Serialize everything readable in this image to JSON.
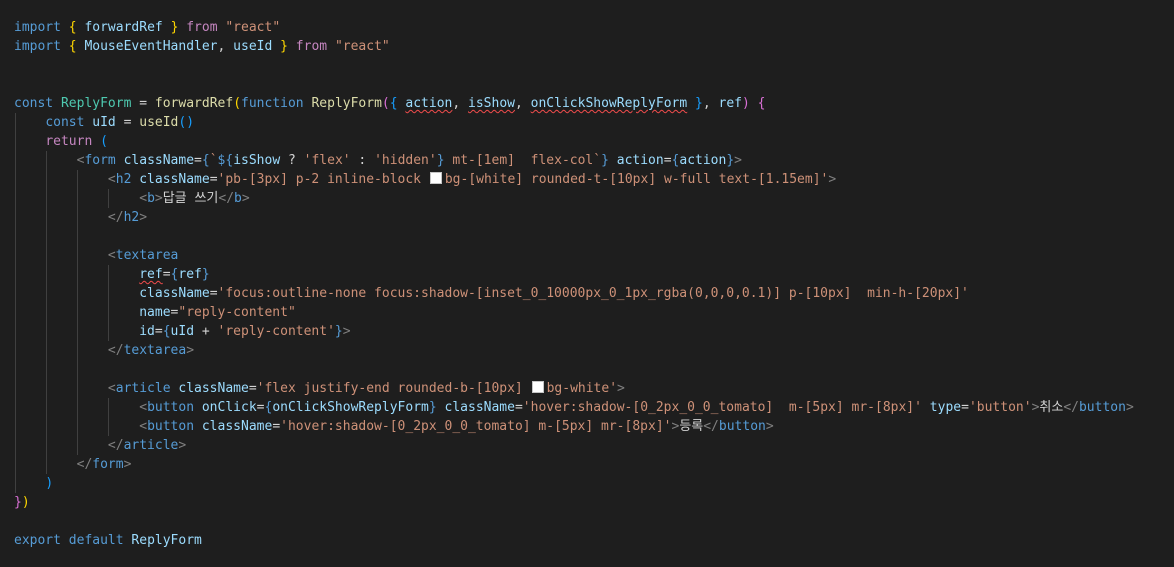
{
  "editor": {
    "background": "#1e1e1e",
    "lines": [
      [
        [
          "k",
          "import"
        ],
        [
          "p",
          " "
        ],
        [
          "y",
          "{"
        ],
        [
          "p",
          " "
        ],
        [
          "v",
          "forwardRef"
        ],
        [
          "p",
          " "
        ],
        [
          "y",
          "}"
        ],
        [
          "p",
          " "
        ],
        [
          "c",
          "from"
        ],
        [
          "p",
          " "
        ],
        [
          "s",
          "\"react\""
        ]
      ],
      [
        [
          "k",
          "import"
        ],
        [
          "p",
          " "
        ],
        [
          "y",
          "{"
        ],
        [
          "p",
          " "
        ],
        [
          "v",
          "MouseEventHandler"
        ],
        [
          "p",
          ", "
        ],
        [
          "v",
          "useId"
        ],
        [
          "p",
          " "
        ],
        [
          "y",
          "}"
        ],
        [
          "p",
          " "
        ],
        [
          "c",
          "from"
        ],
        [
          "p",
          " "
        ],
        [
          "s",
          "\"react\""
        ]
      ],
      [],
      [],
      [
        [
          "k",
          "const"
        ],
        [
          "p",
          " "
        ],
        [
          "ty",
          "ReplyForm"
        ],
        [
          "p",
          " = "
        ],
        [
          "f",
          "forwardRef"
        ],
        [
          "y",
          "("
        ],
        [
          "k",
          "function"
        ],
        [
          "p",
          " "
        ],
        [
          "f",
          "ReplyForm"
        ],
        [
          "m",
          "("
        ],
        [
          "bl",
          "{"
        ],
        [
          "p",
          " "
        ],
        [
          "vq",
          "action"
        ],
        [
          "p",
          ", "
        ],
        [
          "vq",
          "isShow"
        ],
        [
          "p",
          ", "
        ],
        [
          "vq",
          "onClickShowReplyForm"
        ],
        [
          "p",
          " "
        ],
        [
          "bl",
          "}"
        ],
        [
          "p",
          ", "
        ],
        [
          "v",
          "ref"
        ],
        [
          "m",
          ")"
        ],
        [
          "p",
          " "
        ],
        [
          "m",
          "{"
        ]
      ],
      [
        [
          "p",
          "    "
        ],
        [
          "k",
          "const"
        ],
        [
          "p",
          " "
        ],
        [
          "v",
          "uId"
        ],
        [
          "p",
          " = "
        ],
        [
          "f",
          "useId"
        ],
        [
          "bl",
          "()"
        ]
      ],
      [
        [
          "p",
          "    "
        ],
        [
          "c",
          "return"
        ],
        [
          "p",
          " "
        ],
        [
          "bl",
          "("
        ]
      ],
      [
        [
          "p",
          "        "
        ],
        [
          "b",
          "<"
        ],
        [
          "t",
          "form"
        ],
        [
          "p",
          " "
        ],
        [
          "v",
          "className"
        ],
        [
          "p",
          "="
        ],
        [
          "k",
          "{"
        ],
        [
          "s",
          "`"
        ],
        [
          "k",
          "${"
        ],
        [
          "v",
          "isShow"
        ],
        [
          "p",
          " ? "
        ],
        [
          "s",
          "'flex'"
        ],
        [
          "p",
          " : "
        ],
        [
          "s",
          "'hidden'"
        ],
        [
          "k",
          "}"
        ],
        [
          "s",
          " mt-[1em]  flex-col`"
        ],
        [
          "k",
          "}"
        ],
        [
          "p",
          " "
        ],
        [
          "v",
          "action"
        ],
        [
          "p",
          "="
        ],
        [
          "k",
          "{"
        ],
        [
          "v",
          "action"
        ],
        [
          "k",
          "}"
        ],
        [
          "b",
          ">"
        ]
      ],
      [
        [
          "p",
          "            "
        ],
        [
          "b",
          "<"
        ],
        [
          "t",
          "h2"
        ],
        [
          "p",
          " "
        ],
        [
          "v",
          "className"
        ],
        [
          "p",
          "="
        ],
        [
          "s",
          "'pb-[3px] p-2 inline-block "
        ],
        [
          "sw",
          ""
        ],
        [
          "s",
          "bg-[white] rounded-t-[10px] w-full text-[1.15em]'"
        ],
        [
          "b",
          ">"
        ]
      ],
      [
        [
          "p",
          "                "
        ],
        [
          "b",
          "<"
        ],
        [
          "t",
          "b"
        ],
        [
          "b",
          ">"
        ],
        [
          "p",
          "답글 쓰기"
        ],
        [
          "b",
          "</"
        ],
        [
          "t",
          "b"
        ],
        [
          "b",
          ">"
        ]
      ],
      [
        [
          "p",
          "            "
        ],
        [
          "b",
          "</"
        ],
        [
          "t",
          "h2"
        ],
        [
          "b",
          ">"
        ]
      ],
      [],
      [
        [
          "p",
          "            "
        ],
        [
          "b",
          "<"
        ],
        [
          "t",
          "textarea"
        ]
      ],
      [
        [
          "p",
          "                "
        ],
        [
          "vq",
          "ref"
        ],
        [
          "p",
          "="
        ],
        [
          "k",
          "{"
        ],
        [
          "v",
          "ref"
        ],
        [
          "k",
          "}"
        ]
      ],
      [
        [
          "p",
          "                "
        ],
        [
          "v",
          "className"
        ],
        [
          "p",
          "="
        ],
        [
          "s",
          "'focus:outline-none focus:shadow-[inset_0_10000px_0_1px_rgba(0,0,0,0.1)] p-[10px]  min-h-[20px]'"
        ]
      ],
      [
        [
          "p",
          "                "
        ],
        [
          "v",
          "name"
        ],
        [
          "p",
          "="
        ],
        [
          "s",
          "\"reply-content\""
        ]
      ],
      [
        [
          "p",
          "                "
        ],
        [
          "v",
          "id"
        ],
        [
          "p",
          "="
        ],
        [
          "k",
          "{"
        ],
        [
          "v",
          "uId"
        ],
        [
          "p",
          " + "
        ],
        [
          "s",
          "'reply-content'"
        ],
        [
          "k",
          "}"
        ],
        [
          "b",
          ">"
        ]
      ],
      [
        [
          "p",
          "            "
        ],
        [
          "b",
          "</"
        ],
        [
          "t",
          "textarea"
        ],
        [
          "b",
          ">"
        ]
      ],
      [],
      [
        [
          "p",
          "            "
        ],
        [
          "b",
          "<"
        ],
        [
          "t",
          "article"
        ],
        [
          "p",
          " "
        ],
        [
          "v",
          "className"
        ],
        [
          "p",
          "="
        ],
        [
          "s",
          "'flex justify-end rounded-b-[10px] "
        ],
        [
          "sw",
          ""
        ],
        [
          "s",
          "bg-white'"
        ],
        [
          "b",
          ">"
        ]
      ],
      [
        [
          "p",
          "                "
        ],
        [
          "b",
          "<"
        ],
        [
          "t",
          "button"
        ],
        [
          "p",
          " "
        ],
        [
          "v",
          "onClick"
        ],
        [
          "p",
          "="
        ],
        [
          "k",
          "{"
        ],
        [
          "v",
          "onClickShowReplyForm"
        ],
        [
          "k",
          "}"
        ],
        [
          "p",
          " "
        ],
        [
          "v",
          "className"
        ],
        [
          "p",
          "="
        ],
        [
          "s",
          "'hover:shadow-[0_2px_0_0_tomato]  m-[5px] mr-[8px]'"
        ],
        [
          "p",
          " "
        ],
        [
          "v",
          "type"
        ],
        [
          "p",
          "="
        ],
        [
          "s",
          "'button'"
        ],
        [
          "b",
          ">"
        ],
        [
          "p",
          "취소"
        ],
        [
          "b",
          "</"
        ],
        [
          "t",
          "button"
        ],
        [
          "b",
          ">"
        ]
      ],
      [
        [
          "p",
          "                "
        ],
        [
          "b",
          "<"
        ],
        [
          "t",
          "button"
        ],
        [
          "p",
          " "
        ],
        [
          "v",
          "className"
        ],
        [
          "p",
          "="
        ],
        [
          "s",
          "'hover:shadow-[0_2px_0_0_tomato] m-[5px] mr-[8px]'"
        ],
        [
          "b",
          ">"
        ],
        [
          "p",
          "등록"
        ],
        [
          "b",
          "</"
        ],
        [
          "t",
          "button"
        ],
        [
          "b",
          ">"
        ]
      ],
      [
        [
          "p",
          "            "
        ],
        [
          "b",
          "</"
        ],
        [
          "t",
          "article"
        ],
        [
          "b",
          ">"
        ]
      ],
      [
        [
          "p",
          "        "
        ],
        [
          "b",
          "</"
        ],
        [
          "t",
          "form"
        ],
        [
          "b",
          ">"
        ]
      ],
      [
        [
          "p",
          "    "
        ],
        [
          "bl",
          ")"
        ]
      ],
      [
        [
          "m",
          "}"
        ],
        [
          "y",
          ")"
        ]
      ],
      [],
      [
        [
          "k",
          "export"
        ],
        [
          "p",
          " "
        ],
        [
          "k",
          "default"
        ],
        [
          "p",
          " "
        ],
        [
          "v",
          "ReplyForm"
        ]
      ]
    ]
  }
}
